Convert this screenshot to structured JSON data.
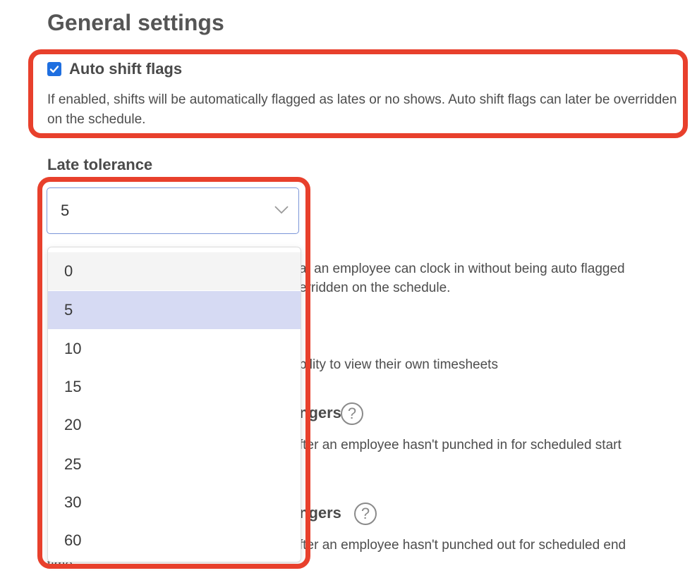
{
  "page": {
    "title": "General settings"
  },
  "auto_shift": {
    "checked": true,
    "label": "Auto shift flags",
    "description": "If enabled, shifts will be automatically flagged as lates or no shows. Auto shift flags can later be overridden on the schedule."
  },
  "late_tolerance": {
    "label": "Late tolerance",
    "selected_value": "5",
    "options": [
      "0",
      "5",
      "10",
      "15",
      "20",
      "25",
      "30",
      "60"
    ],
    "description_line1": "at an employee can clock in without being auto flagged",
    "description_line2": "erridden on the schedule."
  },
  "timesheets": {
    "description": "bility to view their own timesheets"
  },
  "missed_punch_in": {
    "heading": "ngers",
    "description": "fter an employee hasn't punched in for scheduled start"
  },
  "missed_punch_out": {
    "heading": "ngers",
    "description_line1": "fter an employee hasn't punched out for scheduled end",
    "description_line2": "time."
  },
  "help_glyph": "?",
  "colors": {
    "accent": "#1f6fe0",
    "highlight": "#e8402c",
    "selected_option": "#d6daf3"
  }
}
